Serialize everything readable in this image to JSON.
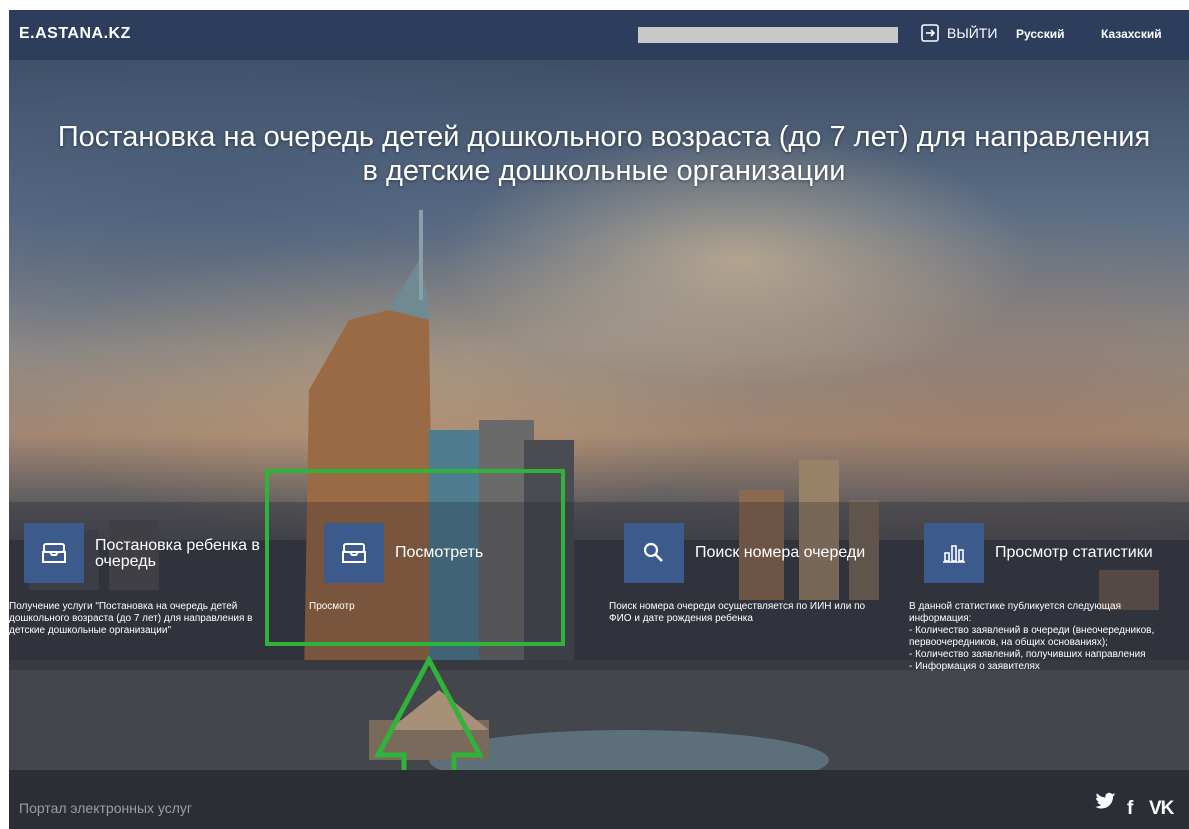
{
  "header": {
    "logo": "E.ASTANA.KZ",
    "logout_label": "ВЫЙТИ",
    "lang_ru": "Русский",
    "lang_kz": "Казахский"
  },
  "hero": {
    "title": "Постановка на очередь детей дошкольного возраста (до 7 лет) для направления в детские дошкольные организации"
  },
  "cards": [
    {
      "icon": "inbox-tray-icon",
      "title": "Постановка ребенка в очередь",
      "desc": "Получение услуги \"Постановка на очередь детей дошкольного возраста (до 7 лет) для направления в детские дошкольные организации\""
    },
    {
      "icon": "inbox-tray-icon",
      "title": "Посмотреть",
      "desc": "Просмотр"
    },
    {
      "icon": "search-icon",
      "title": "Поиск номера очереди",
      "desc": "Поиск номера очереди осуществляется по ИИН или по ФИО и дате рождения ребенка"
    },
    {
      "icon": "bar-chart-icon",
      "title": "Просмотр статистики",
      "desc": "В данной статистике публикуется следующая информация:\n- Количество заявлений в очереди (внеочередников, первоочередников, на общих основаниях);\n- Количество заявлений, получивших направления\n- Информация о заявителях"
    }
  ],
  "footer": {
    "text": "Портал электронных услуг",
    "social_twitter": "🐦",
    "social_facebook": "f",
    "social_vk": "VK"
  },
  "colors": {
    "header_bg": "#2c3e5c",
    "icon_box": "#3c5a8c",
    "highlight": "#2fb33a",
    "footer_bg": "#2b2e34"
  }
}
